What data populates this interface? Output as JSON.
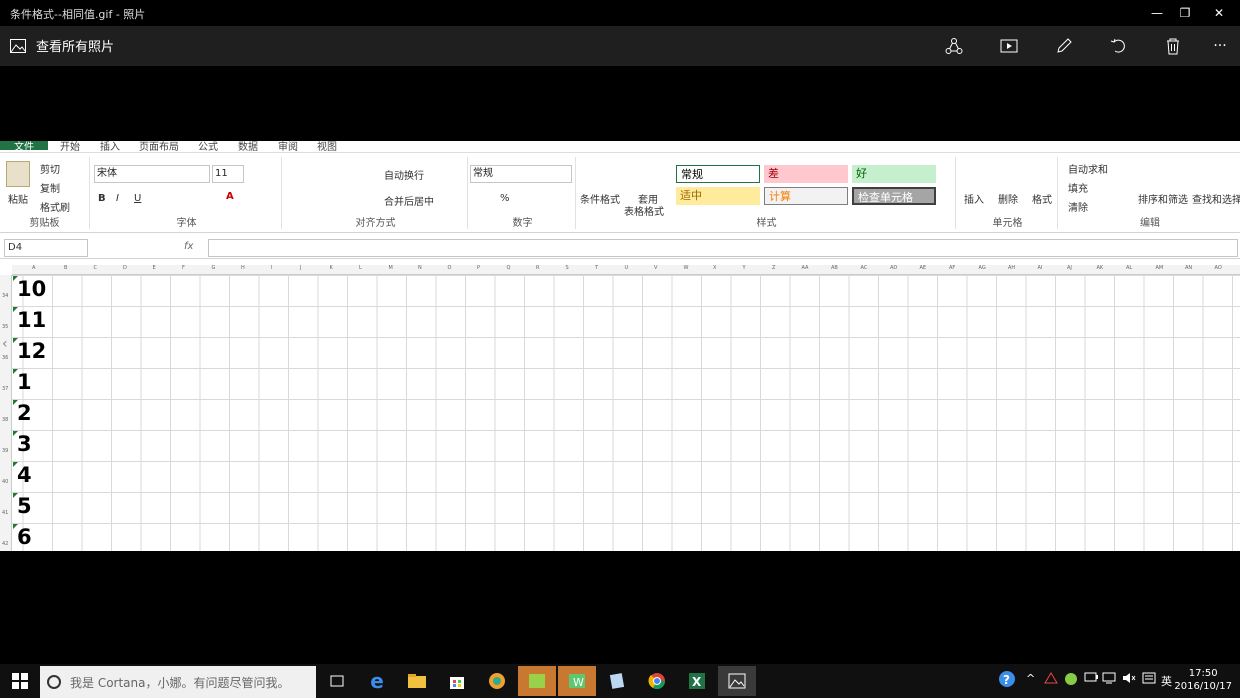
{
  "window": {
    "title": "条件格式--相同值.gif - 照片"
  },
  "appbar": {
    "view_all": "查看所有照片"
  },
  "excel": {
    "tabs": [
      "文件",
      "开始",
      "插入",
      "页面布局",
      "公式",
      "数据",
      "审阅",
      "视图"
    ],
    "clipboard": {
      "paste": "粘贴",
      "cut": "剪切",
      "copy": "复制",
      "painter": "格式刷",
      "label": "剪贴板"
    },
    "font": {
      "name": "宋体",
      "size": "11",
      "label": "字体"
    },
    "align": {
      "wrap": "自动换行",
      "merge": "合并后居中",
      "label": "对齐方式"
    },
    "number": {
      "format": "常规",
      "label": "数字"
    },
    "styles": {
      "cond": "条件格式",
      "table1": "套用",
      "table2": "表格格式",
      "normal": "常规",
      "bad": "差",
      "good": "好",
      "neutral": "适中",
      "calc": "计算",
      "check": "检查单元格",
      "label": "样式"
    },
    "cells": {
      "insert": "插入",
      "delete": "删除",
      "format": "格式",
      "label": "单元格"
    },
    "editing": {
      "autosum": "自动求和",
      "fill": "填充",
      "clear": "清除",
      "sort": "排序和筛选",
      "find": "查找和选择",
      "label": "编辑"
    },
    "namebox": "D4",
    "fx": "fx",
    "columns": [
      "A",
      "B",
      "C",
      "D",
      "E",
      "F",
      "G",
      "H",
      "I",
      "J",
      "K",
      "L",
      "M",
      "N",
      "O",
      "P",
      "Q",
      "R",
      "S",
      "T",
      "U",
      "V",
      "W",
      "X",
      "Y",
      "Z",
      "AA",
      "AB",
      "AC",
      "AD",
      "AE",
      "AF",
      "AG",
      "AH",
      "AI",
      "AJ",
      "AK",
      "AL",
      "AM",
      "AN",
      "AO"
    ],
    "rows": [
      {
        "num": "34",
        "value": "10"
      },
      {
        "num": "35",
        "value": "11"
      },
      {
        "num": "36",
        "value": "12"
      },
      {
        "num": "37",
        "value": "1"
      },
      {
        "num": "38",
        "value": "2"
      },
      {
        "num": "39",
        "value": "3"
      },
      {
        "num": "40",
        "value": "4"
      },
      {
        "num": "41",
        "value": "5"
      },
      {
        "num": "42",
        "value": "6"
      }
    ]
  },
  "taskbar": {
    "cortana": "我是 Cortana，小娜。有问题尽管问我。",
    "ime": "英",
    "time": "17:50",
    "date": "2016/10/17"
  },
  "colors": {
    "excel_green": "#217346",
    "bad_fill": "#ffc7ce",
    "good_fill": "#c6efce",
    "neutral_fill": "#ffeb9c"
  }
}
